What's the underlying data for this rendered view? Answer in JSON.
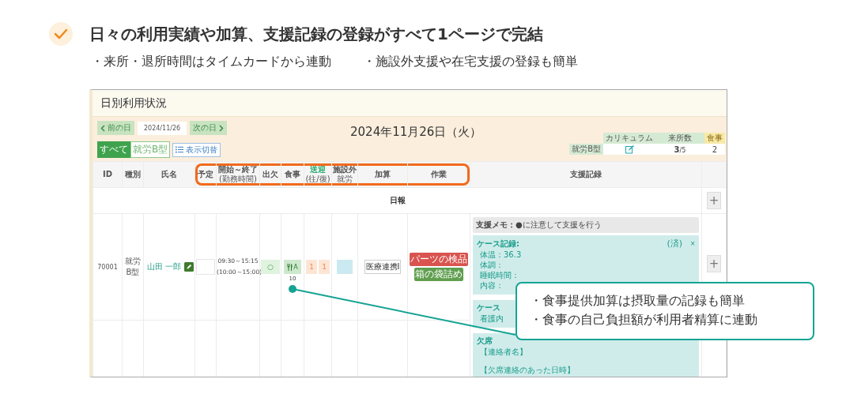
{
  "headline": "日々の利用実績や加算、支援記録の登録がすべて1ページで完結",
  "features": [
    "・来所・退所時間はタイムカードから連動",
    "・施設外支援や在宅支援の登録も簡単"
  ],
  "screen": {
    "title": "日別利用状況",
    "prev_button": "前の日",
    "date_field": "2024/11/26",
    "next_button": "次の日",
    "date_heading": "2024年11月26日（火）",
    "filters": [
      {
        "label": "すべて",
        "selected": true
      },
      {
        "label": "就労B型",
        "selected": false
      }
    ],
    "view_toggle": "表示切替",
    "summary": {
      "columns": [
        {
          "label": "カリキュラム",
          "kind": "plain"
        },
        {
          "label": "来所数",
          "kind": "plain"
        },
        {
          "label": "食事",
          "kind": "meal"
        }
      ],
      "row_label": "就労B型",
      "count": "3",
      "total": "/5",
      "meals": "2"
    },
    "table": {
      "columns": [
        {
          "label": "ID",
          "highlighted": false
        },
        {
          "label": "種別",
          "highlighted": false
        },
        {
          "label": "氏名",
          "highlighted": false
        },
        {
          "label": "予定",
          "highlighted": true
        },
        {
          "label": "開始～終了",
          "sub": "(勤務時間)",
          "highlighted": true
        },
        {
          "label": "出欠",
          "highlighted": true
        },
        {
          "label": "食事",
          "highlighted": true
        },
        {
          "label": "送迎",
          "sub": "(往/復)",
          "accent": true,
          "highlighted": true
        },
        {
          "label": "施設外",
          "sub": "就労",
          "highlighted": true
        },
        {
          "label": "加算",
          "highlighted": true
        },
        {
          "label": "作業",
          "highlighted": true
        },
        {
          "label": "支援記録",
          "highlighted": false
        }
      ],
      "report_label": "日報",
      "report_add": "+",
      "rows": [
        {
          "id": "70001",
          "type": "就労B型",
          "name": "山田 一郎",
          "times": [
            "09:30～15:15",
            "(10:00～15:00)"
          ],
          "attendance": "○",
          "meal": {
            "label": "A",
            "count": "10"
          },
          "transport": [
            "1",
            "1"
          ],
          "addition": "医療連携Ⅰ",
          "tasks": [
            {
              "label": "パーツの検品",
              "color": "#d9534f"
            },
            {
              "label": "箱の袋詰め",
              "color": "#5f9e4e"
            }
          ],
          "memo": "**支援メモ：**●に注意して支援を行う",
          "cards": [
            {
              "title": "ケース記録:",
              "status": "(済)",
              "close": "×",
              "lines": [
                "体温：36.3",
                "体調：",
                "睡眠時間：",
                "内容："
              ]
            },
            {
              "title": "ケース",
              "lines": [
                "看護内"
              ]
            },
            {
              "title": "欠席",
              "lines": [
                "【連絡者名】",
                "【欠席連絡のあった日時】"
              ]
            }
          ],
          "add": "+"
        }
      ]
    }
  },
  "callout": [
    "・食事提供加算は摂取量の記録も簡単",
    "・食事の自己負担額が利用者精算に連動"
  ]
}
